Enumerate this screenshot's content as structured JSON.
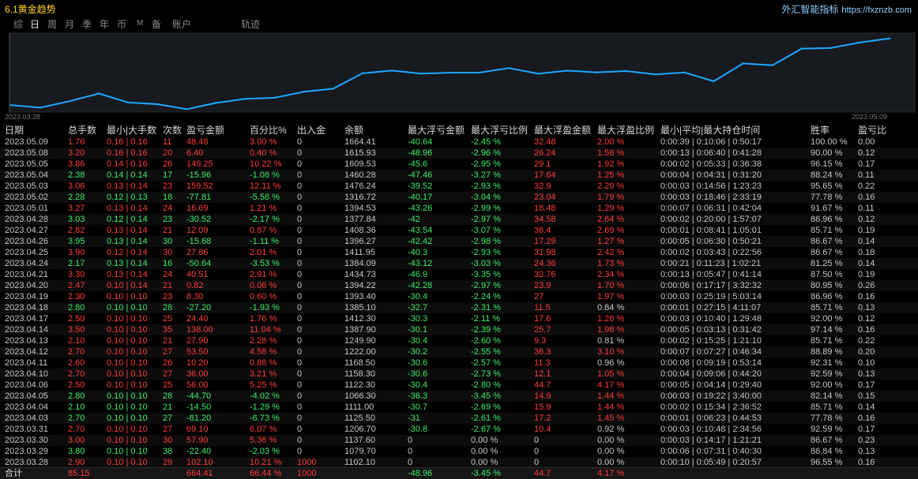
{
  "app": {
    "title": "6.1黄金趋势",
    "brand": "外汇智能指标",
    "brand_url": "https://fxznzb.com"
  },
  "tabs": [
    {
      "label": "综",
      "active": false
    },
    {
      "label": "日",
      "active": true
    },
    {
      "label": "周",
      "active": false
    },
    {
      "label": "月",
      "active": false
    },
    {
      "label": "季",
      "active": false
    },
    {
      "label": "年",
      "active": false
    },
    {
      "label": "币",
      "active": false
    },
    {
      "label": "M",
      "active": false
    },
    {
      "label": "备",
      "active": false
    },
    {
      "label": "账户",
      "active": false
    },
    {
      "label": "轨迹",
      "active": false
    }
  ],
  "colors": {
    "red": "#ff3c3c",
    "green": "#3cf06a",
    "text": "#c8c8c8",
    "line": "#1ea8ff"
  },
  "chart_data": {
    "type": "line",
    "x_start_label": "2023.03.28",
    "x_end_label": "2023.05.09",
    "x": [
      "2023.03.28",
      "2023.03.29",
      "2023.03.30",
      "2023.03.31",
      "2023.04.03",
      "2023.04.04",
      "2023.04.05",
      "2023.04.06",
      "2023.04.07",
      "2023.04.10",
      "2023.04.11",
      "2023.04.12",
      "2023.04.13",
      "2023.04.14",
      "2023.04.17",
      "2023.04.18",
      "2023.04.19",
      "2023.04.20",
      "2023.04.21",
      "2023.04.24",
      "2023.04.25",
      "2023.04.26",
      "2023.04.27",
      "2023.04.28",
      "2023.05.01",
      "2023.05.02",
      "2023.05.03",
      "2023.05.04",
      "2023.05.05",
      "2023.05.08",
      "2023.05.09"
    ],
    "values": [
      1102.1,
      1079.7,
      1137.6,
      1206.7,
      1125.5,
      1111.0,
      1066.3,
      1122.3,
      1158.3,
      1168.5,
      1222.0,
      1249.9,
      1387.9,
      1412.3,
      1385.1,
      1393.4,
      1394.22,
      1434.73,
      1384.09,
      1411.95,
      1396.27,
      1408.36,
      1377.84,
      1394.53,
      1316.72,
      1476.24,
      1460.28,
      1609.53,
      1615.93,
      1664.41,
      1700
    ],
    "ylim": [
      1040,
      1720
    ]
  },
  "table": {
    "headers": [
      "日期",
      "总手数",
      "最小|大手数",
      "次数",
      "盈亏金额",
      "百分比%",
      "出入金",
      "余额",
      "最大浮亏金额",
      "最大浮亏比例",
      "最大浮盈金额",
      "最大浮盈比例",
      "最小|平均|最大持仓时间",
      "胜率",
      "盈亏比"
    ],
    "rows": [
      [
        "2023.05.09",
        "1.76",
        "0.16 | 0.16",
        "11",
        "48.48",
        "3.00 %",
        "0",
        "1664.41",
        "-40.64",
        "-2.45 %",
        "32.48",
        "2.00 %",
        "0:00:39 | 0:10:06 | 0:50:17",
        "100.00 %",
        "0.00"
      ],
      [
        "2023.05.08",
        "3.20",
        "0.16 | 0.16",
        "20",
        "6.40",
        "0.40 %",
        "0",
        "1615.93",
        "-48.96",
        "-2.96 %",
        "26.24",
        "1.58 %",
        "0:00:13 | 0:06:40 | 0:41:28",
        "90.00 %",
        "0.12"
      ],
      [
        "2023.05.05",
        "3.86",
        "0.14 | 0.16",
        "26",
        "149.25",
        "10.22 %",
        "0",
        "1609.53",
        "-45.6",
        "-2.95 %",
        "29.1",
        "1.92 %",
        "0:00:02 | 0:05:33 | 0:36:38",
        "96.15 %",
        "0.17"
      ],
      [
        "2023.05.04",
        "2.38",
        "0.14 | 0.14",
        "17",
        "-15.96",
        "-1.08 %",
        "0",
        "1460.28",
        "-47.46",
        "-3.27 %",
        "17.64",
        "1.25 %",
        "0:00:04 | 0:04:31 | 0:31:20",
        "88.24 %",
        "0.11"
      ],
      [
        "2023.05.03",
        "3.06",
        "0.13 | 0.14",
        "23",
        "159.52",
        "12.11 %",
        "0",
        "1476.24",
        "-39.52",
        "-2.93 %",
        "32.9",
        "2.29 %",
        "0:00:03 | 0:14:56 | 1:23:23",
        "95.65 %",
        "0.22"
      ],
      [
        "2023.05.02",
        "2.28",
        "0.12 | 0.13",
        "18",
        "-77.81",
        "-5.58 %",
        "0",
        "1316.72",
        "-40.17",
        "-3.04 %",
        "23.04",
        "1.79 %",
        "0:00:03 | 0:18:46 | 2:33:19",
        "77.78 %",
        "0.16"
      ],
      [
        "2023.05.01",
        "3.27",
        "0.13 | 0.14",
        "24",
        "16.69",
        "1.21 %",
        "0",
        "1394.53",
        "-43.26",
        "-2.99 %",
        "18.48",
        "1.29 %",
        "0:00:07 | 0:06:31 | 0:42:04",
        "91.67 %",
        "0.11"
      ],
      [
        "2023.04.28",
        "3.03",
        "0.12 | 0.14",
        "23",
        "-30.52",
        "-2.17 %",
        "0",
        "1377.84",
        "-42",
        "-2.97 %",
        "34.58",
        "2.64 %",
        "0:00:02 | 0:20:00 | 1:57:07",
        "86.96 %",
        "0.12"
      ],
      [
        "2023.04.27",
        "2.82",
        "0.13 | 0.14",
        "21",
        "12.09",
        "0.87 %",
        "0",
        "1408.36",
        "-43.54",
        "-3.07 %",
        "36.4",
        "2.69 %",
        "0:00:01 | 0:08:41 | 1:05:01",
        "85.71 %",
        "0.19"
      ],
      [
        "2023.04.26",
        "3.95",
        "0.13 | 0.14",
        "30",
        "-15.68",
        "-1.11 %",
        "0",
        "1396.27",
        "-42.42",
        "-2.98 %",
        "17.29",
        "1.27 %",
        "0:00:05 | 0:06:30 | 0:50:21",
        "86.67 %",
        "0.14"
      ],
      [
        "2023.04.25",
        "3.90",
        "0.12 | 0.14",
        "30",
        "27.86",
        "2.01 %",
        "0",
        "1411.95",
        "-40.3",
        "-2.93 %",
        "31.98",
        "2.42 %",
        "0:00:02 | 0:03:43 | 0:22:56",
        "86.67 %",
        "0.18"
      ],
      [
        "2023.04.24",
        "2.17",
        "0.13 | 0.14",
        "16",
        "-50.64",
        "-3.53 %",
        "0",
        "1384.09",
        "-43.12",
        "-3.03 %",
        "24.36",
        "1.73 %",
        "0:00:21 | 0:11:23 | 1:02:21",
        "81.25 %",
        "0.14"
      ],
      [
        "2023.04.21",
        "3.30",
        "0.13 | 0.14",
        "24",
        "40.51",
        "2.91 %",
        "0",
        "1434.73",
        "-46.9",
        "-3.35 %",
        "32.76",
        "2.34 %",
        "0:00:13 | 0:05:47 | 0:41:14",
        "87.50 %",
        "0.19"
      ],
      [
        "2023.04.20",
        "2.47",
        "0.10 | 0.14",
        "21",
        "0.82",
        "0.06 %",
        "0",
        "1394.22",
        "-42.28",
        "-2.97 %",
        "23.9",
        "1.70 %",
        "0:00:06 | 0:17:17 | 3:32:32",
        "80.95 %",
        "0.26"
      ],
      [
        "2023.04.19",
        "2.30",
        "0.10 | 0.10",
        "23",
        "8.30",
        "0.60 %",
        "0",
        "1393.40",
        "-30.4",
        "-2.24 %",
        "27",
        "1.97 %",
        "0:00:03 | 0:25:19 | 5:03:14",
        "86.96 %",
        "0.16"
      ],
      [
        "2023.04.18",
        "2.80",
        "0.10 | 0.10",
        "28",
        "-27.20",
        "-1.93 %",
        "0",
        "1385.10",
        "-32.7",
        "-2.31 %",
        "11.5",
        "0.84 %",
        "0:00:01 | 0:27:15 | 4:11:07",
        "85.71 %",
        "0.13"
      ],
      [
        "2023.04.17",
        "2.50",
        "0.10 | 0.10",
        "25",
        "24.40",
        "1.76 %",
        "0",
        "1412.30",
        "-30.3",
        "-2.11 %",
        "17.6",
        "1.26 %",
        "0:00:03 | 0:10:40 | 1:29:48",
        "92.00 %",
        "0.12"
      ],
      [
        "2023.04.14",
        "3.50",
        "0.10 | 0.10",
        "35",
        "138.00",
        "11.04 %",
        "0",
        "1387.90",
        "-30.1",
        "-2.39 %",
        "25.7",
        "1.98 %",
        "0:00:05 | 0:03:13 | 0:31:42",
        "97.14 %",
        "0.16"
      ],
      [
        "2023.04.13",
        "2.10",
        "0.10 | 0.10",
        "21",
        "27.90",
        "2.28 %",
        "0",
        "1249.90",
        "-30.4",
        "-2.60 %",
        "9.3",
        "0.81 %",
        "0:00:02 | 0:15:25 | 1:21:10",
        "85.71 %",
        "0.22"
      ],
      [
        "2023.04.12",
        "2.70",
        "0.10 | 0.10",
        "27",
        "53.50",
        "4.58 %",
        "0",
        "1222.00",
        "-30.2",
        "-2.55 %",
        "36.3",
        "3.10 %",
        "0:00:07 | 0:07:27 | 0:46:34",
        "88.89 %",
        "0.20"
      ],
      [
        "2023.04.11",
        "2.60",
        "0.10 | 0.10",
        "26",
        "10.20",
        "0.88 %",
        "0",
        "1168.50",
        "-30.6",
        "-2.57 %",
        "11.3",
        "0.96 %",
        "0:00:08 | 0:09:19 | 0:53:14",
        "92.31 %",
        "0.10"
      ],
      [
        "2023.04.10",
        "2.70",
        "0.10 | 0.10",
        "27",
        "36.00",
        "3.21 %",
        "0",
        "1158.30",
        "-30.6",
        "-2.73 %",
        "12.1",
        "1.05 %",
        "0:00:04 | 0:09:06 | 0:44:20",
        "92.59 %",
        "0.13"
      ],
      [
        "2023.04.06",
        "2.50",
        "0.10 | 0.10",
        "25",
        "56.00",
        "5.25 %",
        "0",
        "1122.30",
        "-30.4",
        "-2.80 %",
        "44.7",
        "4.17 %",
        "0:00:05 | 0:04:14 | 0:29:40",
        "92.00 %",
        "0.17"
      ],
      [
        "2023.04.05",
        "2.80",
        "0.10 | 0.10",
        "28",
        "-44.70",
        "-4.02 %",
        "0",
        "1066.30",
        "-36.3",
        "-3.45 %",
        "14.9",
        "1.44 %",
        "0:00:03 | 0:19:22 | 3:40:00",
        "82.14 %",
        "0.15"
      ],
      [
        "2023.04.04",
        "2.10",
        "0.10 | 0.10",
        "21",
        "-14.50",
        "-1.29 %",
        "0",
        "1111.00",
        "-30.7",
        "-2.69 %",
        "15.9",
        "1.44 %",
        "0:00:02 | 0:15:34 | 2:36:52",
        "85.71 %",
        "0.14"
      ],
      [
        "2023.04.03",
        "2.70",
        "0.10 | 0.10",
        "27",
        "-81.20",
        "-6.73 %",
        "0",
        "1125.50",
        "-31",
        "-2.61 %",
        "17.2",
        "1.45 %",
        "0:00:01 | 0:06:23 | 0:44:53",
        "77.78 %",
        "0.16"
      ],
      [
        "2023.03.31",
        "2.70",
        "0.10 | 0.10",
        "27",
        "69.10",
        "6.07 %",
        "0",
        "1206.70",
        "-30.8",
        "-2.67 %",
        "10.4",
        "0.92 %",
        "0:00:03 | 0:10:48 | 2:34:56",
        "92.59 %",
        "0.17"
      ],
      [
        "2023.03.30",
        "3.00",
        "0.10 | 0.10",
        "30",
        "57.90",
        "5.36 %",
        "0",
        "1137.60",
        "0",
        "0.00 %",
        "0",
        "0.00 %",
        "0:00:03 | 0:14:17 | 1:21:21",
        "86.67 %",
        "0.23"
      ],
      [
        "2023.03.29",
        "3.80",
        "0.10 | 0.10",
        "38",
        "-22.40",
        "-2.03 %",
        "0",
        "1079.70",
        "0",
        "0.00 %",
        "0",
        "0.00 %",
        "0:00:06 | 0:07:31 | 0:40:30",
        "86.84 %",
        "0.13"
      ],
      [
        "2023.03.28",
        "2.90",
        "0.10 | 0.10",
        "29",
        "102.10",
        "10.21 %",
        "1000",
        "1102.10",
        "0",
        "0.00 %",
        "0",
        "0.00 %",
        "0:00:10 | 0:05:49 | 0:20:57",
        "96.55 %",
        "0.16"
      ]
    ],
    "total": [
      "合计",
      "85.15",
      "",
      "",
      "664.41",
      "66.44 %",
      "1000",
      "",
      "-48.96",
      "-3.45 %",
      "44.7",
      "4.17 %",
      "",
      "",
      ""
    ]
  }
}
